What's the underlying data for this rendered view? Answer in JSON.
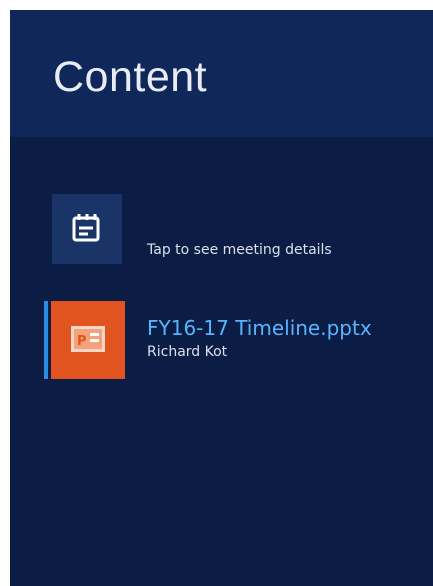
{
  "panel": {
    "title": "Content"
  },
  "meeting": {
    "icon": "meeting-details-icon",
    "label": "Tap to see meeting details"
  },
  "files": [
    {
      "icon": "powerpoint-icon",
      "name": "FY16-17 Timeline.pptx",
      "author": "Richard Kot",
      "selected": true
    }
  ],
  "colors": {
    "background": "#0c1d45",
    "header": "#10275a",
    "tile": "#1b3468",
    "powerpoint_orange": "#e2541f",
    "link_blue": "#59b4ff",
    "selection_blue": "#2b8ce6"
  }
}
